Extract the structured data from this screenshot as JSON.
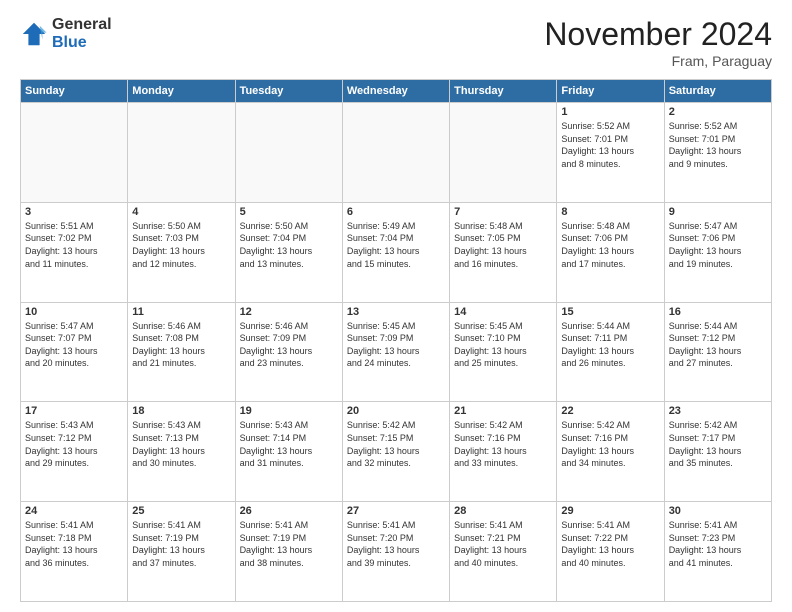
{
  "logo": {
    "general": "General",
    "blue": "Blue"
  },
  "header": {
    "title": "November 2024",
    "location": "Fram, Paraguay"
  },
  "weekdays": [
    "Sunday",
    "Monday",
    "Tuesday",
    "Wednesday",
    "Thursday",
    "Friday",
    "Saturday"
  ],
  "weeks": [
    [
      {
        "day": "",
        "info": ""
      },
      {
        "day": "",
        "info": ""
      },
      {
        "day": "",
        "info": ""
      },
      {
        "day": "",
        "info": ""
      },
      {
        "day": "",
        "info": ""
      },
      {
        "day": "1",
        "info": "Sunrise: 5:52 AM\nSunset: 7:01 PM\nDaylight: 13 hours\nand 8 minutes."
      },
      {
        "day": "2",
        "info": "Sunrise: 5:52 AM\nSunset: 7:01 PM\nDaylight: 13 hours\nand 9 minutes."
      }
    ],
    [
      {
        "day": "3",
        "info": "Sunrise: 5:51 AM\nSunset: 7:02 PM\nDaylight: 13 hours\nand 11 minutes."
      },
      {
        "day": "4",
        "info": "Sunrise: 5:50 AM\nSunset: 7:03 PM\nDaylight: 13 hours\nand 12 minutes."
      },
      {
        "day": "5",
        "info": "Sunrise: 5:50 AM\nSunset: 7:04 PM\nDaylight: 13 hours\nand 13 minutes."
      },
      {
        "day": "6",
        "info": "Sunrise: 5:49 AM\nSunset: 7:04 PM\nDaylight: 13 hours\nand 15 minutes."
      },
      {
        "day": "7",
        "info": "Sunrise: 5:48 AM\nSunset: 7:05 PM\nDaylight: 13 hours\nand 16 minutes."
      },
      {
        "day": "8",
        "info": "Sunrise: 5:48 AM\nSunset: 7:06 PM\nDaylight: 13 hours\nand 17 minutes."
      },
      {
        "day": "9",
        "info": "Sunrise: 5:47 AM\nSunset: 7:06 PM\nDaylight: 13 hours\nand 19 minutes."
      }
    ],
    [
      {
        "day": "10",
        "info": "Sunrise: 5:47 AM\nSunset: 7:07 PM\nDaylight: 13 hours\nand 20 minutes."
      },
      {
        "day": "11",
        "info": "Sunrise: 5:46 AM\nSunset: 7:08 PM\nDaylight: 13 hours\nand 21 minutes."
      },
      {
        "day": "12",
        "info": "Sunrise: 5:46 AM\nSunset: 7:09 PM\nDaylight: 13 hours\nand 23 minutes."
      },
      {
        "day": "13",
        "info": "Sunrise: 5:45 AM\nSunset: 7:09 PM\nDaylight: 13 hours\nand 24 minutes."
      },
      {
        "day": "14",
        "info": "Sunrise: 5:45 AM\nSunset: 7:10 PM\nDaylight: 13 hours\nand 25 minutes."
      },
      {
        "day": "15",
        "info": "Sunrise: 5:44 AM\nSunset: 7:11 PM\nDaylight: 13 hours\nand 26 minutes."
      },
      {
        "day": "16",
        "info": "Sunrise: 5:44 AM\nSunset: 7:12 PM\nDaylight: 13 hours\nand 27 minutes."
      }
    ],
    [
      {
        "day": "17",
        "info": "Sunrise: 5:43 AM\nSunset: 7:12 PM\nDaylight: 13 hours\nand 29 minutes."
      },
      {
        "day": "18",
        "info": "Sunrise: 5:43 AM\nSunset: 7:13 PM\nDaylight: 13 hours\nand 30 minutes."
      },
      {
        "day": "19",
        "info": "Sunrise: 5:43 AM\nSunset: 7:14 PM\nDaylight: 13 hours\nand 31 minutes."
      },
      {
        "day": "20",
        "info": "Sunrise: 5:42 AM\nSunset: 7:15 PM\nDaylight: 13 hours\nand 32 minutes."
      },
      {
        "day": "21",
        "info": "Sunrise: 5:42 AM\nSunset: 7:16 PM\nDaylight: 13 hours\nand 33 minutes."
      },
      {
        "day": "22",
        "info": "Sunrise: 5:42 AM\nSunset: 7:16 PM\nDaylight: 13 hours\nand 34 minutes."
      },
      {
        "day": "23",
        "info": "Sunrise: 5:42 AM\nSunset: 7:17 PM\nDaylight: 13 hours\nand 35 minutes."
      }
    ],
    [
      {
        "day": "24",
        "info": "Sunrise: 5:41 AM\nSunset: 7:18 PM\nDaylight: 13 hours\nand 36 minutes."
      },
      {
        "day": "25",
        "info": "Sunrise: 5:41 AM\nSunset: 7:19 PM\nDaylight: 13 hours\nand 37 minutes."
      },
      {
        "day": "26",
        "info": "Sunrise: 5:41 AM\nSunset: 7:19 PM\nDaylight: 13 hours\nand 38 minutes."
      },
      {
        "day": "27",
        "info": "Sunrise: 5:41 AM\nSunset: 7:20 PM\nDaylight: 13 hours\nand 39 minutes."
      },
      {
        "day": "28",
        "info": "Sunrise: 5:41 AM\nSunset: 7:21 PM\nDaylight: 13 hours\nand 40 minutes."
      },
      {
        "day": "29",
        "info": "Sunrise: 5:41 AM\nSunset: 7:22 PM\nDaylight: 13 hours\nand 40 minutes."
      },
      {
        "day": "30",
        "info": "Sunrise: 5:41 AM\nSunset: 7:23 PM\nDaylight: 13 hours\nand 41 minutes."
      }
    ]
  ]
}
